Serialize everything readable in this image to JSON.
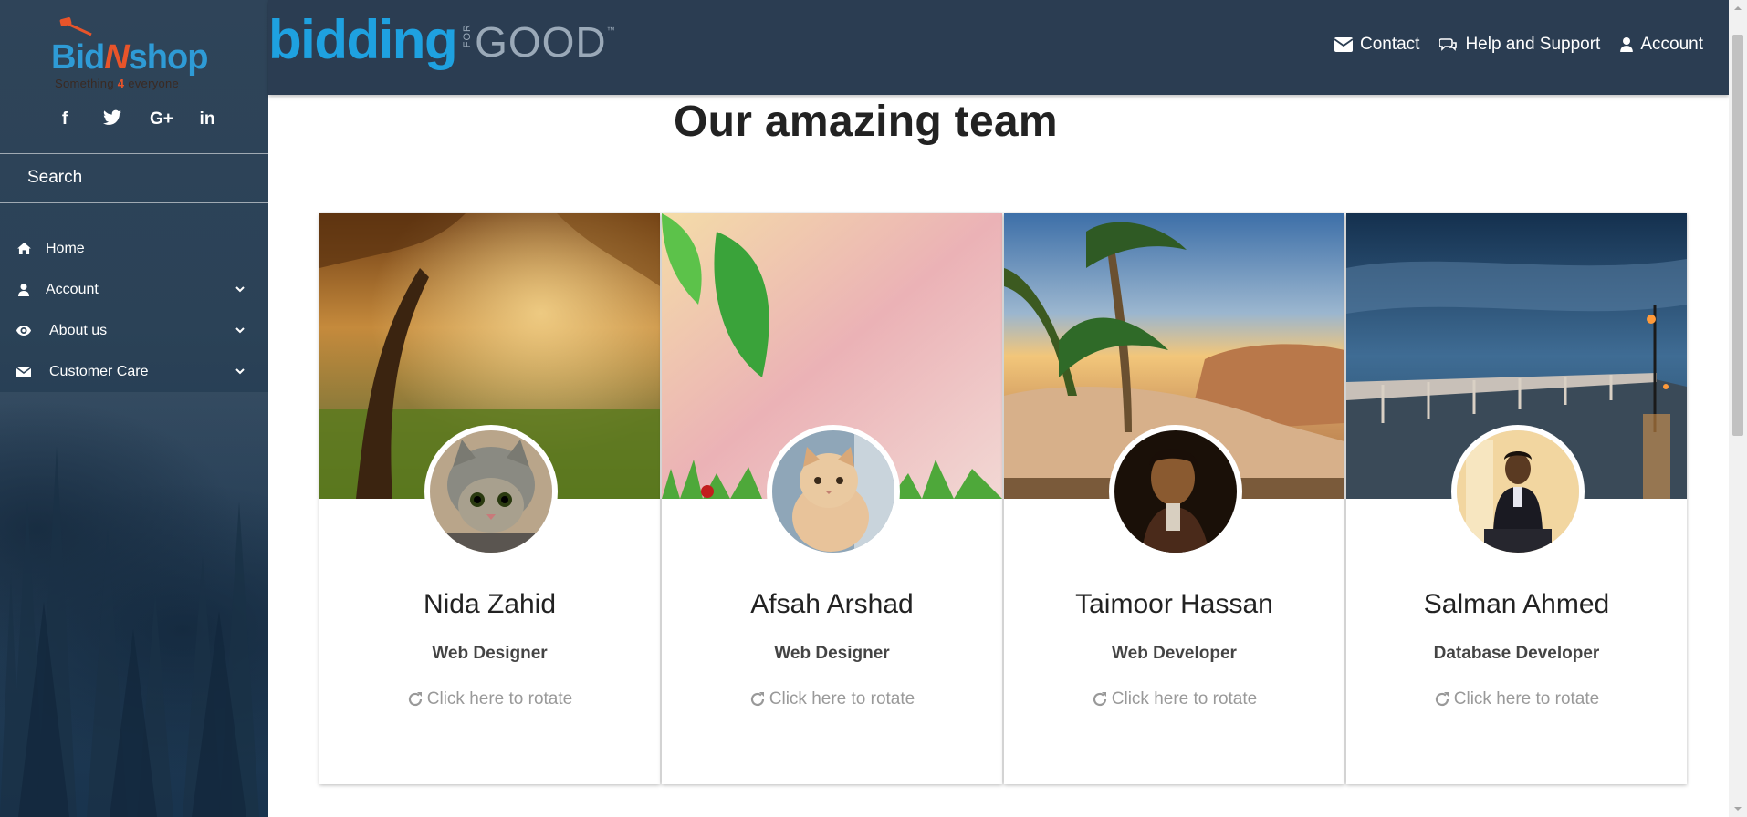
{
  "sidebar": {
    "logo": {
      "part1": "Bid",
      "part2": "N",
      "part3": "shop",
      "tag_before": "Something ",
      "tag_num": "4",
      "tag_after": " everyone"
    },
    "socials": [
      {
        "label": "f",
        "icon": "facebook-icon"
      },
      {
        "label": "t",
        "icon": "twitter-icon"
      },
      {
        "label": "G+",
        "icon": "google-plus-icon"
      },
      {
        "label": "in",
        "icon": "linkedin-icon"
      }
    ],
    "search_label": "Search",
    "items": [
      {
        "label": "Home",
        "icon": "home-icon",
        "has_submenu": false
      },
      {
        "label": "Account",
        "icon": "user-icon",
        "has_submenu": true
      },
      {
        "label": "About us",
        "icon": "eye-icon",
        "has_submenu": true
      },
      {
        "label": "Customer Care",
        "icon": "envelope-icon",
        "has_submenu": true
      }
    ]
  },
  "header": {
    "brand_main": "bidding",
    "brand_for": "FOR",
    "brand_good": "GOOD",
    "brand_tm": "™",
    "links": [
      {
        "label": "Contact",
        "icon": "envelope-icon"
      },
      {
        "label": "Help and Support",
        "icon": "chat-icon"
      },
      {
        "label": "Account",
        "icon": "user-icon"
      }
    ]
  },
  "main": {
    "title": "Our amazing team",
    "members": [
      {
        "name": "Nida Zahid",
        "role": "Web Designer",
        "action": "Click here to rotate"
      },
      {
        "name": "Afsah Arshad",
        "role": "Web Designer",
        "action": "Click here to rotate"
      },
      {
        "name": "Taimoor Hassan",
        "role": "Web Developer",
        "action": "Click here to rotate"
      },
      {
        "name": "Salman Ahmed",
        "role": "Database Developer",
        "action": "Click here to rotate"
      }
    ]
  },
  "colors": {
    "sidebar_bg": "#2f4459",
    "topbar_bg": "#2b3d52",
    "brand_blue": "#1ea1e0",
    "logo_orange": "#e8542a"
  }
}
